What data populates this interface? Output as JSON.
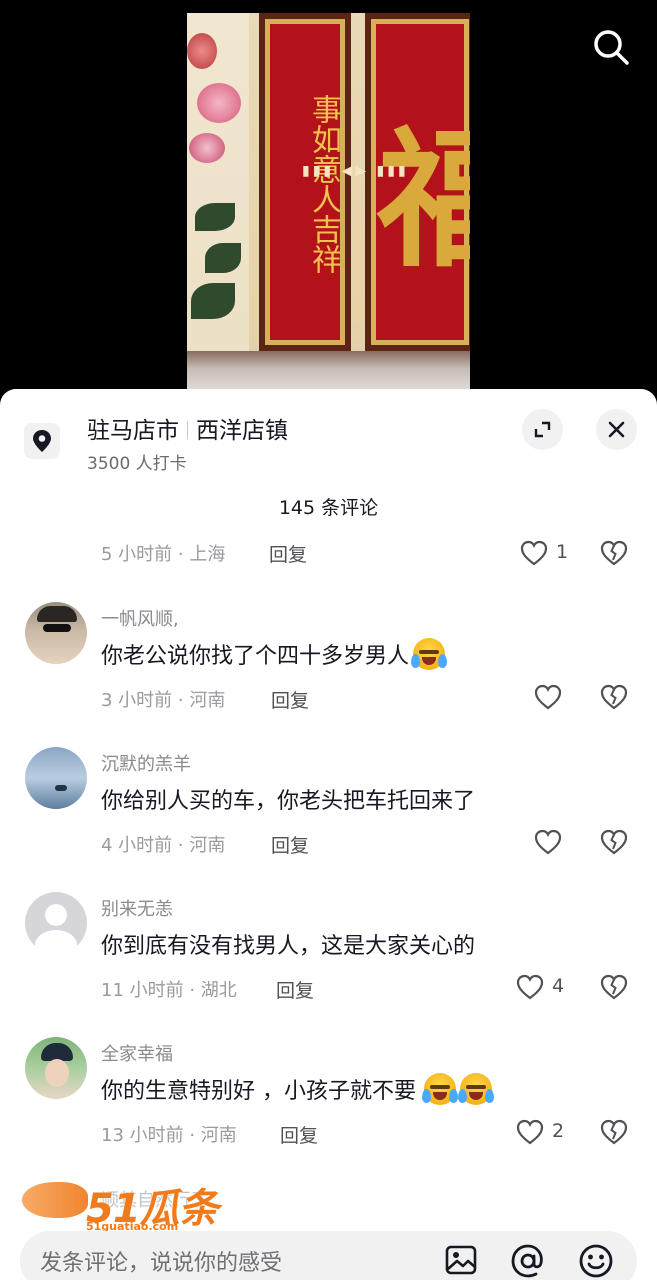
{
  "video": {
    "scroll_left_text": "事如意人吉祥",
    "panel_right_glyph": "福"
  },
  "location": {
    "city": "驻马店市",
    "town": "西洋店镇",
    "checkins": "3500 人打卡"
  },
  "comments_header": {
    "count_label": "145 条评论"
  },
  "partial_comment": {
    "time_location": "5 小时前 · 上海",
    "reply_label": "回复",
    "like_count": "1"
  },
  "comments": [
    {
      "user": "一帆风顺,",
      "text": "你老公说你找了个四十多岁男人",
      "emoji": "😭",
      "time_location": "3 小时前 · 河南",
      "reply_label": "回复",
      "like_count": ""
    },
    {
      "user": "沉默的羔羊",
      "text": "你给别人买的车，你老头把车托回来了",
      "emoji": "",
      "time_location": "4 小时前 · 河南",
      "reply_label": "回复",
      "like_count": ""
    },
    {
      "user": "别来无恙",
      "text": "你到底有没有找男人，这是大家关心的",
      "emoji": "",
      "time_location": "11 小时前 · 湖北",
      "reply_label": "回复",
      "like_count": "4"
    },
    {
      "user": "全家幸福",
      "text": "你的生意特别好 ，小孩子就不要",
      "emoji": "😭😭",
      "time_location": "13 小时前 · 河南",
      "reply_label": "回复",
      "like_count": "2"
    }
  ],
  "next_comment_partial": {
    "user": "顺其自然行了"
  },
  "input": {
    "placeholder": "发条评论，说说你的感受"
  },
  "watermark": {
    "logo": "51瓜条",
    "url": "51guatiao.com"
  },
  "icons": {
    "search": "search-icon",
    "location": "location-pin-icon",
    "expand": "expand-icon",
    "close": "close-icon",
    "like": "heart-outline-icon",
    "dislike": "broken-heart-icon",
    "image": "image-icon",
    "mention": "at-icon",
    "emoji": "emoji-icon"
  }
}
